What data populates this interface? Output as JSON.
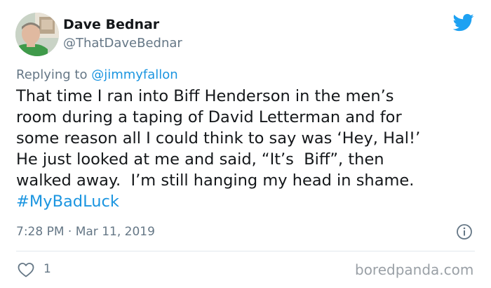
{
  "author": {
    "display_name": "Dave Bednar",
    "handle": "@ThatDaveBednar"
  },
  "reply": {
    "prefix": "Replying to ",
    "mention": "@jimmyfallon"
  },
  "tweet": {
    "text": "That time I ran into Biff Henderson in the men’s\nroom during a taping of David Letterman and for\nsome reason all I could think to say was ‘Hey, Hal!’\nHe just looked at me and said, “It’s  Biff”, then\nwalked away.  I’m still hanging my head in shame.",
    "hashtag": "#MyBadLuck",
    "timestamp": "7:28 PM · Mar 11, 2019"
  },
  "engagement": {
    "like_count": "1"
  },
  "watermark": "boredpanda.com",
  "icons": {
    "brand": "twitter-bird-icon",
    "info": "info-icon",
    "like": "heart-icon"
  },
  "colors": {
    "twitter_blue": "#1da1f2",
    "link_blue": "#1b95e0",
    "secondary_text": "#657786",
    "primary_text": "#14171a",
    "divider": "#e1e8ed"
  }
}
